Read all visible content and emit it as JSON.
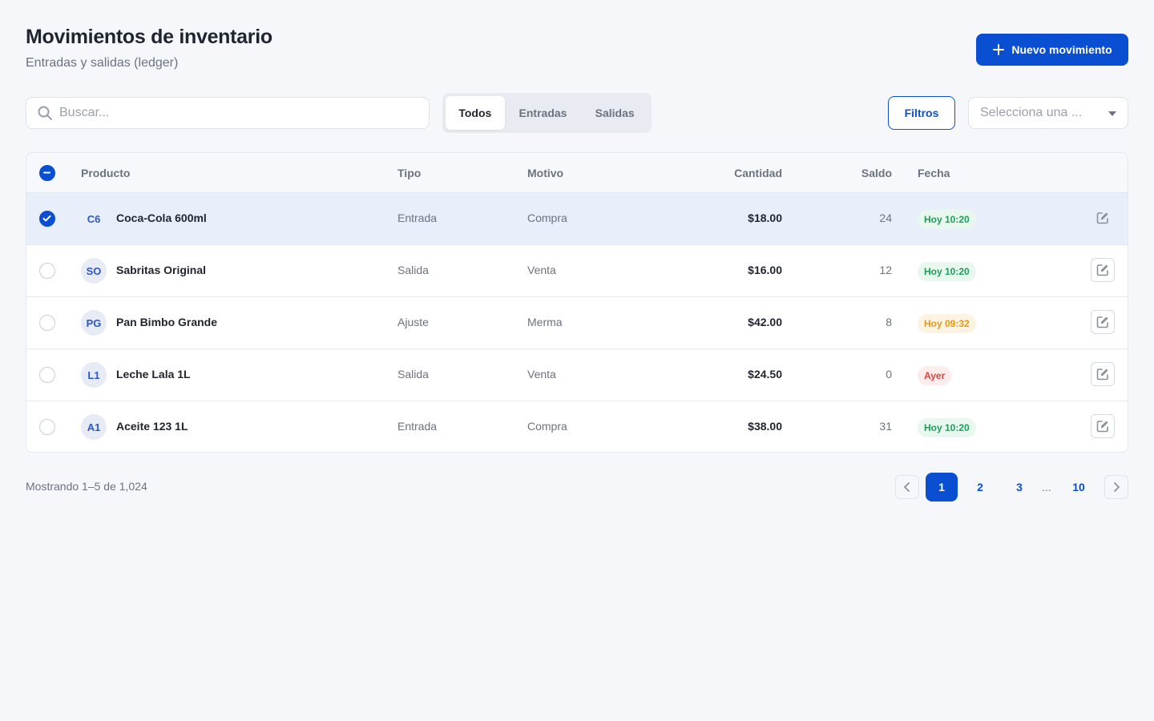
{
  "header": {
    "title": "Movimientos de inventario",
    "subtitle": "Entradas y salidas (ledger)",
    "primary_action": "Nuevo movimiento"
  },
  "toolbar": {
    "search_placeholder": "Buscar...",
    "segments": [
      "Todos",
      "Entradas",
      "Salidas"
    ],
    "active_segment": "Todos",
    "filters_label": "Filtros",
    "select_placeholder": "Selecciona una ..."
  },
  "table": {
    "columns": [
      "Producto",
      "Tipo",
      "Motivo",
      "Cantidad",
      "Saldo",
      "Fecha"
    ],
    "rows": [
      {
        "initials": "C6",
        "product": "Coca-Cola 600ml",
        "tipo": "Entrada",
        "motivo": "Compra",
        "cantidad": "$18.00",
        "saldo": "24",
        "fecha": "Hoy 10:20",
        "fecha_status": "green",
        "selected": true
      },
      {
        "initials": "SO",
        "product": "Sabritas Original",
        "tipo": "Salida",
        "motivo": "Venta",
        "cantidad": "$16.00",
        "saldo": "12",
        "fecha": "Hoy 10:20",
        "fecha_status": "green",
        "selected": false
      },
      {
        "initials": "PG",
        "product": "Pan Bimbo Grande",
        "tipo": "Ajuste",
        "motivo": "Merma",
        "cantidad": "$42.00",
        "saldo": "8",
        "fecha": "Hoy 09:32",
        "fecha_status": "orange",
        "selected": false
      },
      {
        "initials": "L1",
        "product": "Leche Lala 1L",
        "tipo": "Salida",
        "motivo": "Venta",
        "cantidad": "$24.50",
        "saldo": "0",
        "fecha": "Ayer",
        "fecha_status": "red",
        "selected": false
      },
      {
        "initials": "A1",
        "product": "Aceite 123 1L",
        "tipo": "Entrada",
        "motivo": "Compra",
        "cantidad": "$38.00",
        "saldo": "31",
        "fecha": "Hoy 10:20",
        "fecha_status": "green",
        "selected": false
      }
    ]
  },
  "pagination": {
    "summary": "Mostrando 1–5 de 1,024",
    "pages": [
      "1",
      "2",
      "3",
      "10"
    ],
    "ellipsis": "...",
    "current": "1"
  },
  "colors": {
    "primary": "#0a4fd1",
    "status_green": "#1f9d5a",
    "status_orange": "#e59a16",
    "status_red": "#de4343"
  },
  "icons": [
    "plus-icon",
    "search-icon",
    "chevron-down-icon",
    "check-icon",
    "minus-icon",
    "edit-icon",
    "chevron-left-icon",
    "chevron-right-icon"
  ]
}
